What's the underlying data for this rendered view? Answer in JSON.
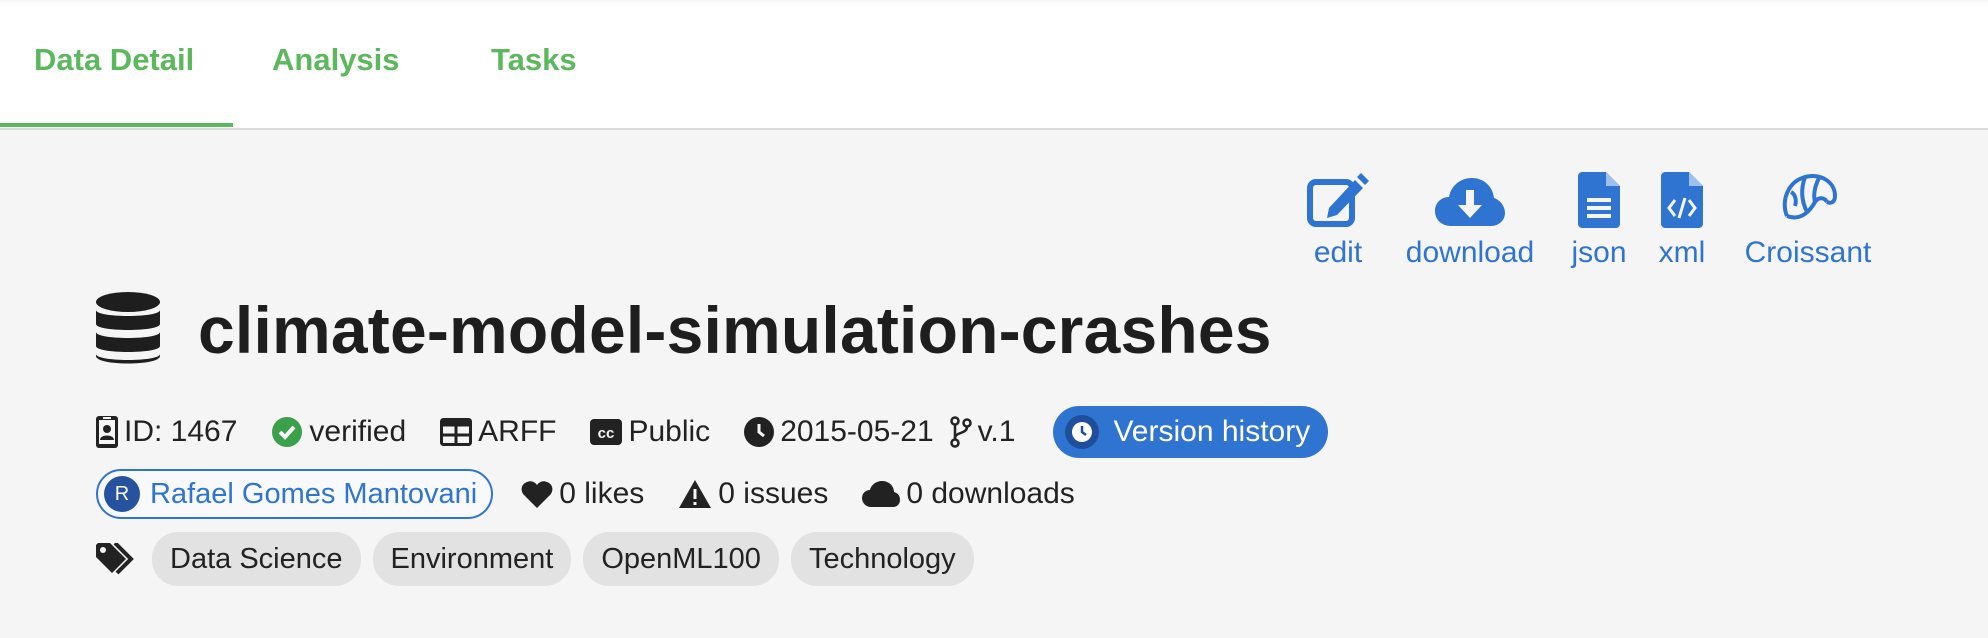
{
  "tabs": [
    {
      "label": "Data Detail"
    },
    {
      "label": "Analysis"
    },
    {
      "label": "Tasks"
    }
  ],
  "actions": {
    "edit": "edit",
    "download": "download",
    "json": "json",
    "xml": "xml",
    "croissant": "Croissant"
  },
  "dataset": {
    "title": "climate-model-simulation-crashes",
    "id": "ID: 1467",
    "status": "verified",
    "format": "ARFF",
    "license": "Public",
    "date": "2015-05-21",
    "version": "v.1",
    "version_history": "Version history",
    "author": "Rafael Gomes Mantovani",
    "author_initial": "R",
    "likes": "0 likes",
    "issues": "0 issues",
    "downloads": "0 downloads",
    "tags": [
      "Data Science",
      "Environment",
      "OpenML100",
      "Technology"
    ]
  },
  "colors": {
    "tab_active": "#5cb85c",
    "accent_blue": "#2f74d0",
    "verified_green": "#3aa14a",
    "tag_bg": "#e2e2e2"
  },
  "icons": [
    "database-icon",
    "id-card-icon",
    "check-circle-icon",
    "table-icon",
    "cc-icon",
    "clock-icon",
    "branch-icon",
    "user-avatar",
    "heart-icon",
    "warning-icon",
    "cloud-icon",
    "tags-icon",
    "edit-icon",
    "cloud-download-icon",
    "file-text-icon",
    "file-code-icon",
    "croissant-icon"
  ]
}
